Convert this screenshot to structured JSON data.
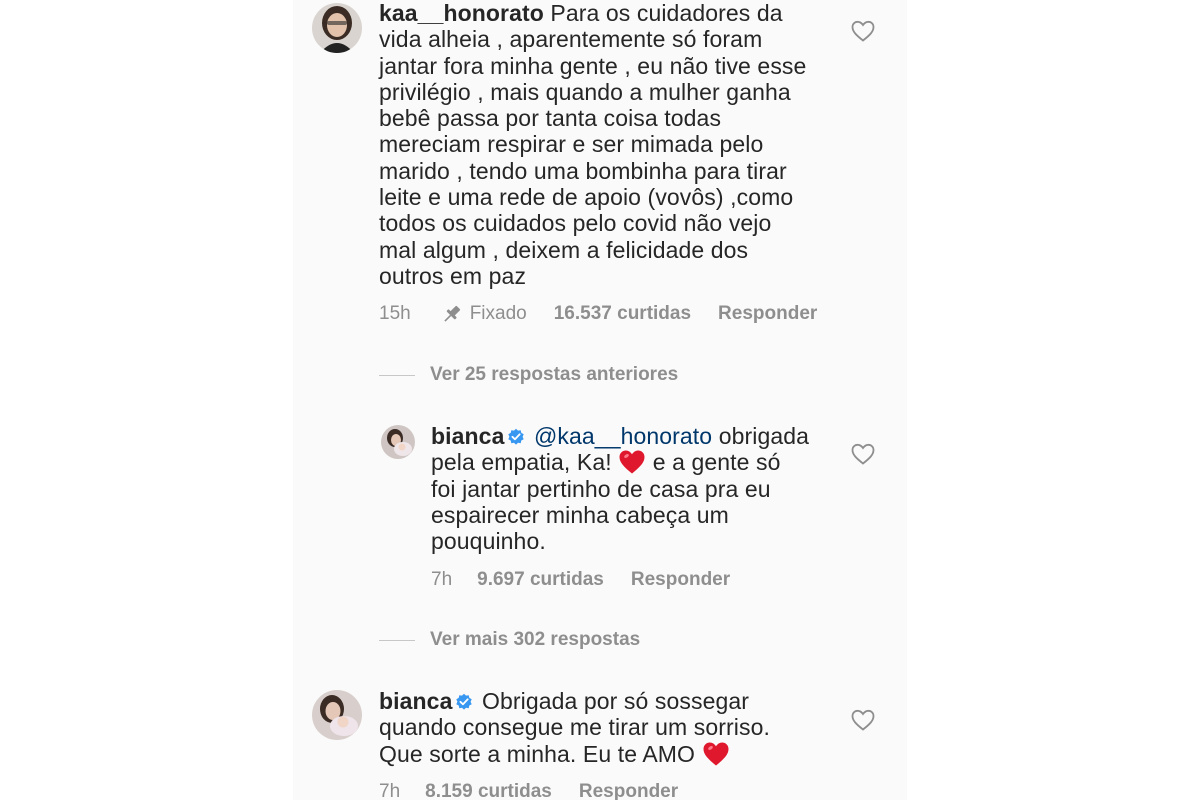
{
  "comments": [
    {
      "username": "kaa__honorato",
      "verified": false,
      "lines": [
        "Para os cuidadores da",
        "vida alheia , aparentemente só foram",
        "jantar fora minha gente , eu não tive esse",
        "privilégio , mais quando a mulher ganha",
        "bebê passa por tanta coisa todas",
        "mereciam respirar e ser mimada pelo",
        "marido , tendo uma bombinha para tirar",
        "leite e uma rede de apoio (vovôs) ,como",
        "todos os cuidados pelo covid  não vejo",
        "mal algum , deixem a felicidade dos",
        "outros em paz"
      ],
      "time": "15h",
      "pinned_label": "Fixado",
      "likes": "16.537 curtidas",
      "reply_label": "Responder",
      "icons": {
        "like": "heart-outline-icon",
        "pin": "pin-icon"
      }
    }
  ],
  "view_previous_replies": "Ver 25 respostas anteriores",
  "reply": {
    "username": "bianca",
    "verified": true,
    "mention": "@kaa__honorato",
    "line1_rest": "obrigada",
    "line2_start": "pela empatia, Ka!",
    "line2_end": "e a gente só",
    "lines_rest": [
      "foi jantar pertinho de casa pra eu",
      "espairecer minha cabeça um",
      "pouquinho."
    ],
    "time": "7h",
    "likes": "9.697 curtidas",
    "reply_label": "Responder"
  },
  "view_more_replies": "Ver mais 302 respostas",
  "comment2": {
    "username": "bianca",
    "verified": true,
    "line1_rest": "Obrigada por só sossegar",
    "line2": "quando consegue me tirar um sorriso.",
    "line3": "Que sorte a minha. Eu te AMO",
    "time": "7h",
    "likes": "8.159 curtidas",
    "reply_label": "Responder"
  },
  "colors": {
    "text": "#262626",
    "secondary": "#8e8e8e",
    "mention": "#00376b",
    "verified_blue": "#3897f0",
    "heart_red": "#e0182d"
  }
}
